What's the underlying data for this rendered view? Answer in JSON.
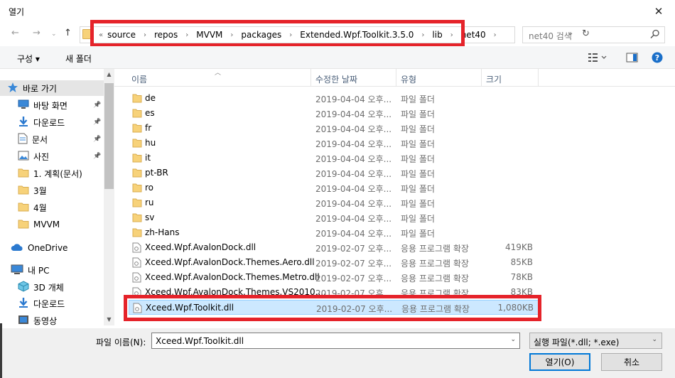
{
  "window": {
    "title": "열기",
    "close_glyph": "✕"
  },
  "address": {
    "lead": "«",
    "crumbs": [
      "source",
      "repos",
      "MVVM",
      "packages",
      "Extended.Wpf.Toolkit.3.5.0",
      "lib",
      "net40"
    ],
    "separator": "›"
  },
  "search": {
    "placeholder": "net40 검색"
  },
  "toolbar": {
    "organize": "구성 ▾",
    "new_folder": "새 폴더"
  },
  "nav": {
    "items": [
      {
        "label": "바로 가기",
        "icon": "star-icon"
      },
      {
        "label": "바탕 화면",
        "icon": "desktop-icon",
        "pinned": true
      },
      {
        "label": "다운로드",
        "icon": "download-icon",
        "pinned": true
      },
      {
        "label": "문서",
        "icon": "document-icon",
        "pinned": true
      },
      {
        "label": "사진",
        "icon": "picture-icon",
        "pinned": true
      },
      {
        "label": "1. 계획(문서)",
        "icon": "folder-icon"
      },
      {
        "label": "3월",
        "icon": "folder-icon"
      },
      {
        "label": "4월",
        "icon": "folder-icon"
      },
      {
        "label": "MVVM",
        "icon": "folder-icon"
      },
      {
        "label": "OneDrive",
        "icon": "cloud-icon"
      },
      {
        "label": "내 PC",
        "icon": "pc-icon"
      },
      {
        "label": "3D 개체",
        "icon": "cube-icon"
      },
      {
        "label": "다운로드",
        "icon": "download-icon"
      },
      {
        "label": "동영상",
        "icon": "video-icon"
      }
    ]
  },
  "columns": {
    "name": "이름",
    "date": "수정한 날짜",
    "type": "유형",
    "size": "크기"
  },
  "files": [
    {
      "name": "de",
      "date": "2019-04-04 오후...",
      "type": "파일 폴더",
      "size": "",
      "kind": "folder"
    },
    {
      "name": "es",
      "date": "2019-04-04 오후...",
      "type": "파일 폴더",
      "size": "",
      "kind": "folder"
    },
    {
      "name": "fr",
      "date": "2019-04-04 오후...",
      "type": "파일 폴더",
      "size": "",
      "kind": "folder"
    },
    {
      "name": "hu",
      "date": "2019-04-04 오후...",
      "type": "파일 폴더",
      "size": "",
      "kind": "folder"
    },
    {
      "name": "it",
      "date": "2019-04-04 오후...",
      "type": "파일 폴더",
      "size": "",
      "kind": "folder"
    },
    {
      "name": "pt-BR",
      "date": "2019-04-04 오후...",
      "type": "파일 폴더",
      "size": "",
      "kind": "folder"
    },
    {
      "name": "ro",
      "date": "2019-04-04 오후...",
      "type": "파일 폴더",
      "size": "",
      "kind": "folder"
    },
    {
      "name": "ru",
      "date": "2019-04-04 오후...",
      "type": "파일 폴더",
      "size": "",
      "kind": "folder"
    },
    {
      "name": "sv",
      "date": "2019-04-04 오후...",
      "type": "파일 폴더",
      "size": "",
      "kind": "folder"
    },
    {
      "name": "zh-Hans",
      "date": "2019-04-04 오후...",
      "type": "파일 폴더",
      "size": "",
      "kind": "folder"
    },
    {
      "name": "Xceed.Wpf.AvalonDock.dll",
      "date": "2019-02-07 오후...",
      "type": "응용 프로그램 확장",
      "size": "419KB",
      "kind": "dll"
    },
    {
      "name": "Xceed.Wpf.AvalonDock.Themes.Aero.dll",
      "date": "2019-02-07 오후...",
      "type": "응용 프로그램 확장",
      "size": "85KB",
      "kind": "dll"
    },
    {
      "name": "Xceed.Wpf.AvalonDock.Themes.Metro.dll",
      "date": "2019-02-07 오후...",
      "type": "응용 프로그램 확장",
      "size": "78KB",
      "kind": "dll"
    },
    {
      "name": "Xceed.Wpf.AvalonDock.Themes.VS2010....",
      "date": "2019-02-07 오후...",
      "type": "응용 프로그램 확장",
      "size": "83KB",
      "kind": "dll"
    },
    {
      "name": "Xceed.Wpf.Toolkit.dll",
      "date": "2019-02-07 오후...",
      "type": "응용 프로그램 확장",
      "size": "1,080KB",
      "kind": "dll",
      "selected": true
    }
  ],
  "bottom": {
    "filename_label": "파일 이름(N):",
    "filename_value": "Xceed.Wpf.Toolkit.dll",
    "filetype_value": "실행 파일(*.dll; *.exe)",
    "open_label": "열기(O)",
    "cancel_label": "취소"
  },
  "colors": {
    "highlight": "#e5232a",
    "selection": "#cce8ff",
    "accent": "#0078d7"
  }
}
